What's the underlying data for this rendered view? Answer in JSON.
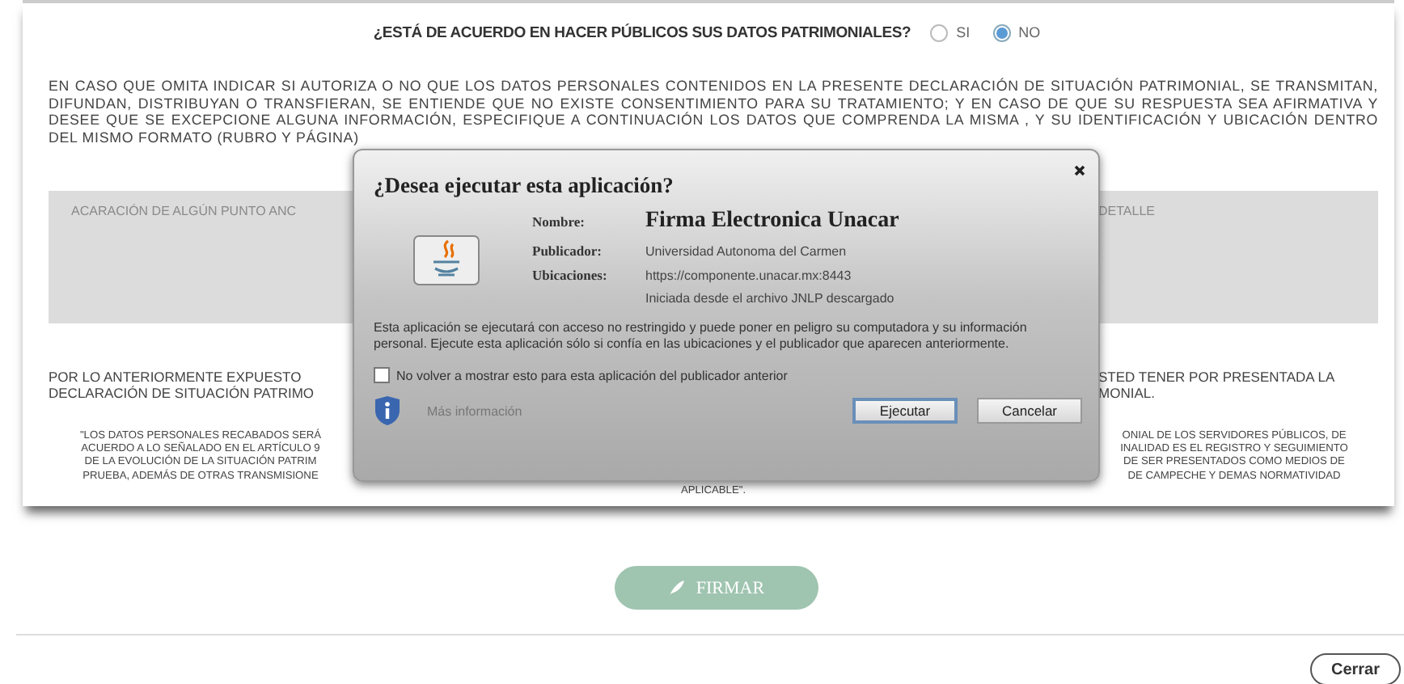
{
  "question": {
    "text": "¿ESTÁ DE ACUERDO EN HACER PÚBLICOS SUS DATOS PATRIMONIALES?",
    "options": [
      {
        "label": "SI",
        "selected": false
      },
      {
        "label": "NO",
        "selected": true
      }
    ]
  },
  "notice": "EN CASO QUE OMITA INDICAR SI AUTORIZA O NO QUE LOS DATOS PERSONALES CONTENIDOS EN LA PRESENTE DECLARACIÓN DE SITUACIÓN PATRIMONIAL, SE TRANSMITAN, DIFUNDAN, DISTRIBUYAN O TRANSFIERAN, SE ENTIENDE QUE NO EXISTE CONSENTIMIENTO PARA SU TRATAMIENTO; Y EN CASO DE QUE SU RESPUESTA SEA AFIRMATIVA Y DESEE QUE SE EXCEPCIONE ALGUNA INFORMACIÓN, ESPECIFIQUE A CONTINUACIÓN LOS DATOS QUE COMPRENDA LA MISMA , Y SU IDENTIFICACIÓN Y UBICACIÓN DENTRO DEL MISMO FORMATO (RUBRO Y PÁGINA)",
  "table": {
    "column_1": "ACARACIÓN DE ALGÚN PUNTO ANC",
    "column_2": "DETALLE"
  },
  "statement": {
    "left_lines": [
      "POR LO ANTERIORMENTE EXPUESTO",
      "DECLARACIÓN DE SITUACIÓN PATRIMO"
    ],
    "right_lines": [
      "STED TENER POR PRESENTADA LA",
      "MONIAL."
    ]
  },
  "footnote": {
    "left_lines": [
      "\"LOS DATOS PERSONALES RECABADOS SERÁ",
      "ACUERDO A LO SEÑALADO EN EL ARTÍCULO 9",
      "DE LA EVOLUCIÓN DE LA SITUACIÓN PATRIM",
      "PRUEBA, ADEMÁS DE OTRAS TRANSMISIONE"
    ],
    "right_lines": [
      "ONIAL DE LOS SERVIDORES PÚBLICOS, DE",
      "INALIDAD ES EL REGISTRO Y SEGUIMIENTO",
      "DE SER PRESENTADOS COMO MEDIOS DE",
      "DE CAMPECHE Y DEMAS NORMATIVIDAD"
    ],
    "last_line": "APLICABLE\"."
  },
  "sign_button": {
    "label": "FIRMAR"
  },
  "close_button": {
    "label": "Cerrar"
  },
  "dialog": {
    "title": "¿Desea ejecutar esta aplicación?",
    "fields": [
      {
        "label": "Nombre:",
        "kind": "name",
        "values": [
          "Firma Electronica Unacar"
        ]
      },
      {
        "label": "Publicador:",
        "kind": "plain",
        "values": [
          "Universidad Autonoma del Carmen"
        ]
      },
      {
        "label": "Ubicaciones:",
        "kind": "plain",
        "values": [
          "https://componente.unacar.mx:8443",
          "Iniciada desde el archivo JNLP descargado"
        ]
      }
    ],
    "warning": "Esta aplicación se ejecutará con acceso no restringido y puede poner en peligro su computadora y su información personal. Ejecute esta aplicación sólo si confía en las ubicaciones y el publicador que aparecen anteriormente.",
    "checkbox": {
      "label": "No volver a mostrar esto para esta aplicación del publicador anterior",
      "checked": false
    },
    "more_info": "Más información",
    "buttons": [
      {
        "label": "Ejecutar",
        "focused": true
      },
      {
        "label": "Cancelar",
        "focused": false
      }
    ]
  }
}
